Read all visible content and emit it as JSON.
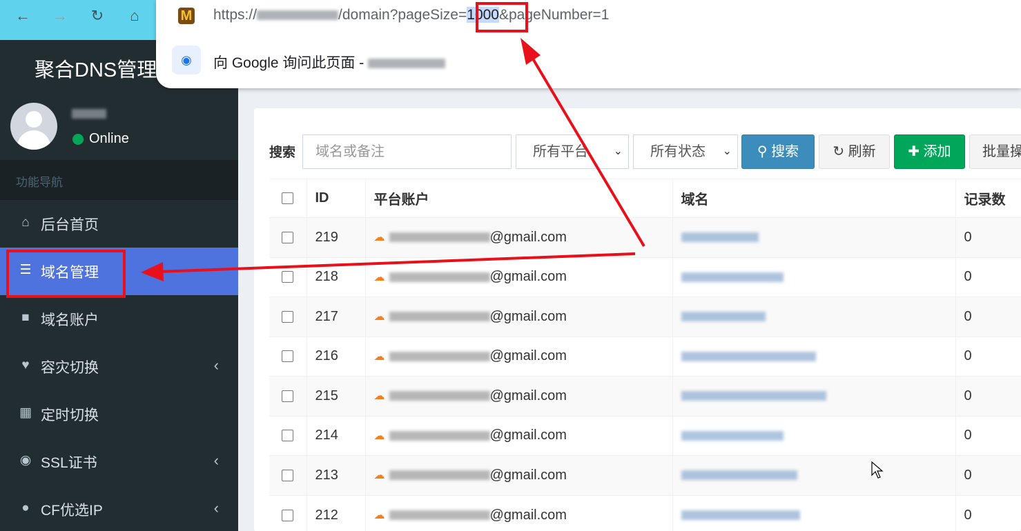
{
  "browser": {
    "url_prefix": "https://",
    "url_middle": "/domain?pageSize=",
    "url_selected": "1000",
    "url_suffix": "&pageNumber=1",
    "suggestion_text": "向 Google 询问此页面 - ",
    "favicon_letter": "M"
  },
  "sidebar": {
    "brand": "聚合DNS管理",
    "status": "Online",
    "nav_header": "功能导航",
    "items": [
      {
        "label": "后台首页",
        "icon": "home-icon"
      },
      {
        "label": "域名管理",
        "icon": "list-icon"
      },
      {
        "label": "域名账户",
        "icon": "lock-icon"
      },
      {
        "label": "容灾切换",
        "icon": "heartbeat-icon"
      },
      {
        "label": "定时切换",
        "icon": "calendar-icon"
      },
      {
        "label": "SSL证书",
        "icon": "lock-circle-icon"
      },
      {
        "label": "CF优选IP",
        "icon": "globe-icon"
      }
    ]
  },
  "toolbar": {
    "search_label": "搜索",
    "search_placeholder": "域名或备注",
    "platform_select": "所有平台",
    "status_select": "所有状态",
    "search_button": "搜索",
    "refresh_button": "刷新",
    "add_button": "添加",
    "batch_button": "批量操"
  },
  "table": {
    "headers": [
      "ID",
      "平台账户",
      "域名",
      "记录数"
    ],
    "email_suffix": "@gmail.com",
    "rows": [
      {
        "id": "219",
        "records": "0"
      },
      {
        "id": "218",
        "records": "0"
      },
      {
        "id": "217",
        "records": "0"
      },
      {
        "id": "216",
        "records": "0"
      },
      {
        "id": "215",
        "records": "0"
      },
      {
        "id": "214",
        "records": "0"
      },
      {
        "id": "213",
        "records": "0"
      },
      {
        "id": "212",
        "records": "0"
      }
    ]
  },
  "colors": {
    "accent": "#4e73df",
    "annotation": "#e8101a",
    "sidebar_bg": "#222d32"
  }
}
